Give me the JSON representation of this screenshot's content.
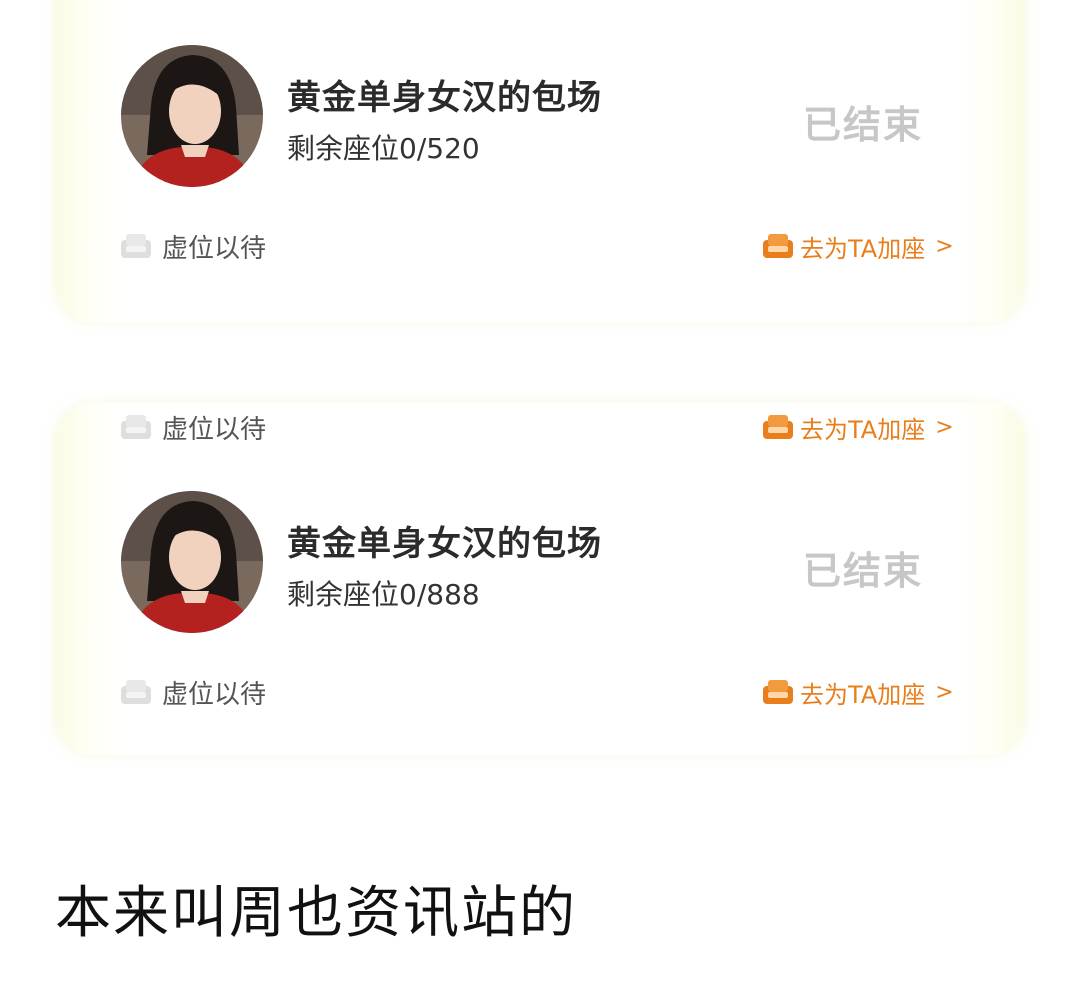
{
  "cards": [
    {
      "title": "黄金单身女汉的包场",
      "seats_label": "剩余座位0/520",
      "status": "已结束",
      "reserve_label": "虚位以待",
      "add_seat_label": "去为TA加座",
      "chevron": ">"
    },
    {
      "top_reserve_label": "虚位以待",
      "top_add_seat_label": "去为TA加座",
      "top_chevron": ">",
      "title": "黄金单身女汉的包场",
      "seats_label": "剩余座位0/888",
      "status": "已结束",
      "reserve_label": "虚位以待",
      "add_seat_label": "去为TA加座",
      "chevron": ">"
    }
  ],
  "caption": "本来叫周也资讯站的",
  "colors": {
    "accent": "#e87e1c",
    "status_gray": "#c7c7c7",
    "seat_icon_gray": "#d6d6d6",
    "card_edge": "#fbfbe6"
  },
  "icons": {
    "avatar": "avatar-photo",
    "reserve": "empty-seat-icon",
    "add_seat": "orange-seat-icon"
  }
}
